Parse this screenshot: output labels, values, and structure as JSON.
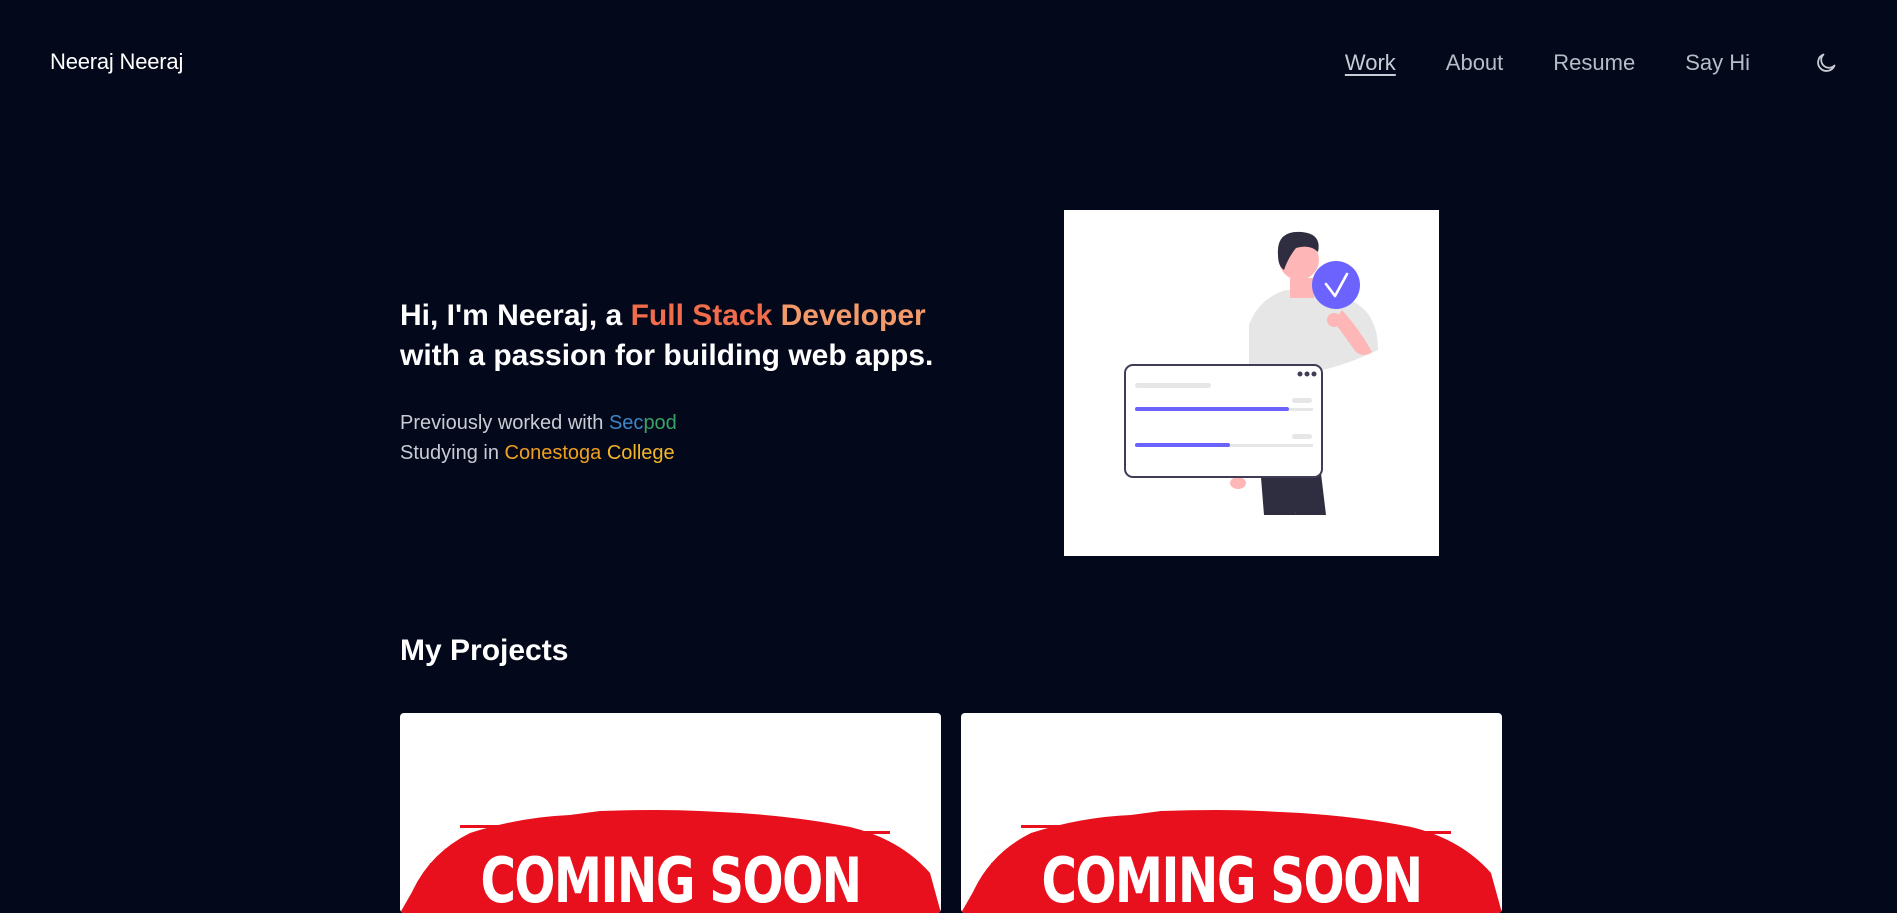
{
  "header": {
    "brand": "Neeraj Neeraj",
    "nav": [
      {
        "label": "Work",
        "active": true
      },
      {
        "label": "About",
        "active": false
      },
      {
        "label": "Resume",
        "active": false
      },
      {
        "label": "Say Hi",
        "active": false
      }
    ],
    "theme_toggle_icon": "moon-icon"
  },
  "hero": {
    "greeting_prefix": "Hi, I'm Neeraj, a ",
    "highlight_a": "Full Stack ",
    "highlight_b": "Developer",
    "greeting_line2": "with a passion for building web apps.",
    "prev_work_label": "Previously worked with ",
    "prev_work_a": "Sec",
    "prev_work_b": "pod",
    "study_label": "Studying in ",
    "study_a": "Conestoga ",
    "study_b": "College",
    "illustration": "person-with-checkmark-illustration"
  },
  "projects": {
    "title": "My Projects",
    "cards": [
      {
        "banner_text": "COMING SOON"
      },
      {
        "banner_text": "COMING SOON"
      }
    ]
  },
  "colors": {
    "background": "#03081a",
    "accent_orange": "#f06c4a",
    "secpod_blue": "#3e86c6",
    "conestoga_orange": "#f0a020",
    "coming_soon_red": "#e8101c",
    "illustration_purple": "#6c63ff"
  }
}
